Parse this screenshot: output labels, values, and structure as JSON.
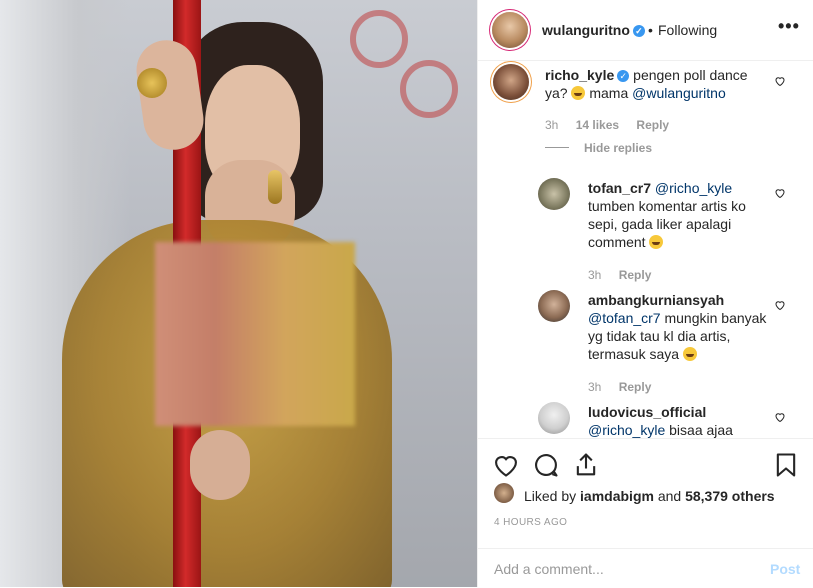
{
  "post": {
    "author": "wulanguritno",
    "following_label": "Following",
    "dot": "•",
    "more": "•••"
  },
  "comments": [
    {
      "user": "richo_kyle",
      "verified": true,
      "text_before": "pengen poll dance ya?",
      "text_after": "mama",
      "mention": "@wulanguritno",
      "time": "3h",
      "likes": "14 likes",
      "reply": "Reply",
      "hide_replies": "Hide replies"
    }
  ],
  "replies": [
    {
      "user": "tofan_cr7",
      "mention": "@richo_kyle",
      "text": "tumben komentar artis ko sepi, gada liker apalagi comment",
      "time": "3h",
      "reply": "Reply"
    },
    {
      "user": "ambangkurniansyah",
      "mention": "@tofan_cr7",
      "text": "mungkin banyak yg tidak tau kl dia artis, termasuk saya",
      "time": "3h",
      "reply": "Reply"
    },
    {
      "user": "ludovicus_official",
      "mention": "@richo_kyle",
      "text": "bisaa ajaa",
      "time": "",
      "reply": ""
    }
  ],
  "likes": {
    "prefix": "Liked by",
    "user": "iamdabigm",
    "middle": "and",
    "count": "58,379 others"
  },
  "timestamp": "4 HOURS AGO",
  "add_comment": {
    "placeholder": "Add a comment...",
    "post_label": "Post"
  },
  "icons": [
    "heart-icon",
    "comment-icon",
    "share-icon",
    "bookmark-icon"
  ],
  "colors": {
    "link": "#003569",
    "verified": "#3897f0",
    "post_disabled": "#b3dbff"
  }
}
